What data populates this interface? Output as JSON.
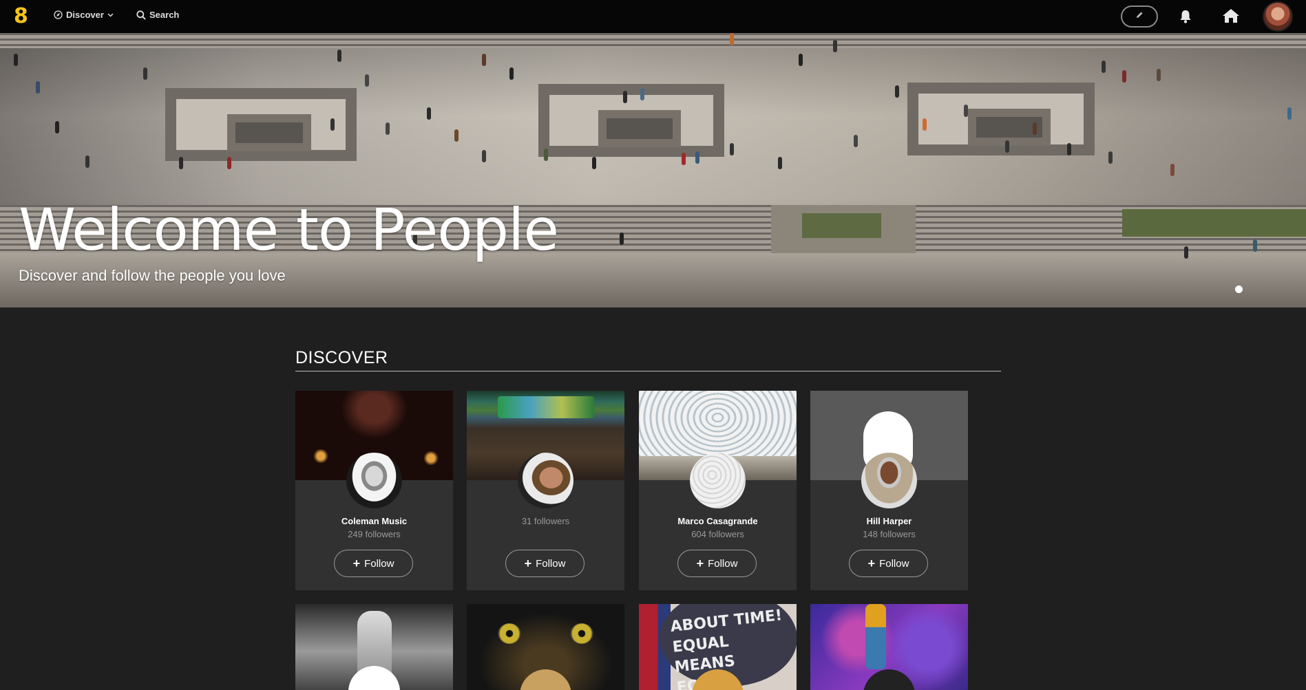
{
  "header": {
    "logo": "8",
    "discover_label": "Discover",
    "search_label": "Search"
  },
  "hero": {
    "title": "Welcome to People",
    "subtitle": "Discover and follow the people you love"
  },
  "discover": {
    "title": "DISCOVER",
    "follow_label": "Follow",
    "cards": [
      {
        "name": "Coleman Music",
        "followers": "249 followers"
      },
      {
        "name": "",
        "followers": "31 followers"
      },
      {
        "name": "Marco Casagrande",
        "followers": "604 followers"
      },
      {
        "name": "Hill Harper",
        "followers": "148 followers"
      }
    ],
    "second_row_text": {
      "card3_banner": "ABOUT TIME! EQUAL MEANS EQUAL"
    }
  },
  "colors": {
    "logo": "#f5c518",
    "background": "#1f1f1f",
    "card": "#313131",
    "topbar": "#060606"
  },
  "icons": [
    "discover-compass-icon",
    "chevron-down-icon",
    "search-icon",
    "pencil-icon",
    "bell-icon",
    "home-icon",
    "plus-icon"
  ]
}
